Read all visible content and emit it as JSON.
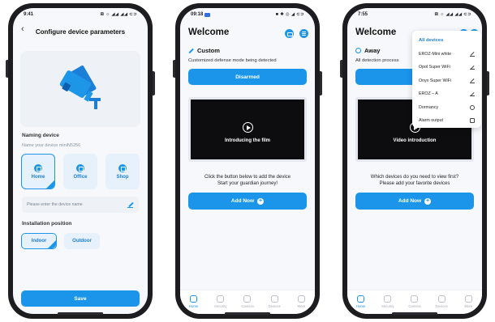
{
  "phone1": {
    "status_time": "9:41",
    "status_icons": "⊠ ☼ ◢◢ ◢◢ ⊂⊃",
    "title": "Configure device parameters",
    "naming_label": "Naming device",
    "name_hint": "Name your device miniN5256",
    "rooms": [
      "Home",
      "Office",
      "Shop"
    ],
    "name_placeholder": "Please enter the device name",
    "position_label": "Installation position",
    "positions": [
      "Indoor",
      "Outdoor"
    ],
    "save_label": "Save"
  },
  "phone2": {
    "status_time": "09:18",
    "status_icons": "■ ✱ ◎ ◢ ⊂⊃",
    "title": "Welcome",
    "mode": "Custom",
    "mode_desc": "Customized defense mode being detected",
    "action_label": "Disarmed",
    "video_caption": "Introducing the film",
    "prompt_line1": "Click the button below to add the device",
    "prompt_line2": "Start your guardian journey!",
    "add_label": "Add Now"
  },
  "phone3": {
    "status_time": "7:55",
    "status_icons": "⊠ ☼ ◢◢ ◢◢ ⊂⊃",
    "title": "Welcome",
    "mode": "Away",
    "mode_desc": "All detection process",
    "action_label": "D",
    "video_caption": "Video introduction",
    "prompt_line1": "Which devices do you need to view first?",
    "prompt_line2": "Please add your favorite devices",
    "add_label": "Add Now",
    "menu": {
      "header": "All devices",
      "items": [
        "EROZ-Mini white",
        "Opol Super WiFi",
        "Onyx Super WiFi",
        "EROZ – A"
      ],
      "dormancy": "Dormancy",
      "alarm_output": "Alarm output"
    }
  },
  "tabs": [
    "Home",
    "Security",
    "Camera",
    "Devices",
    "More"
  ],
  "colors": {
    "accent": "#1b95ea",
    "bg": "#f6f8fb"
  }
}
